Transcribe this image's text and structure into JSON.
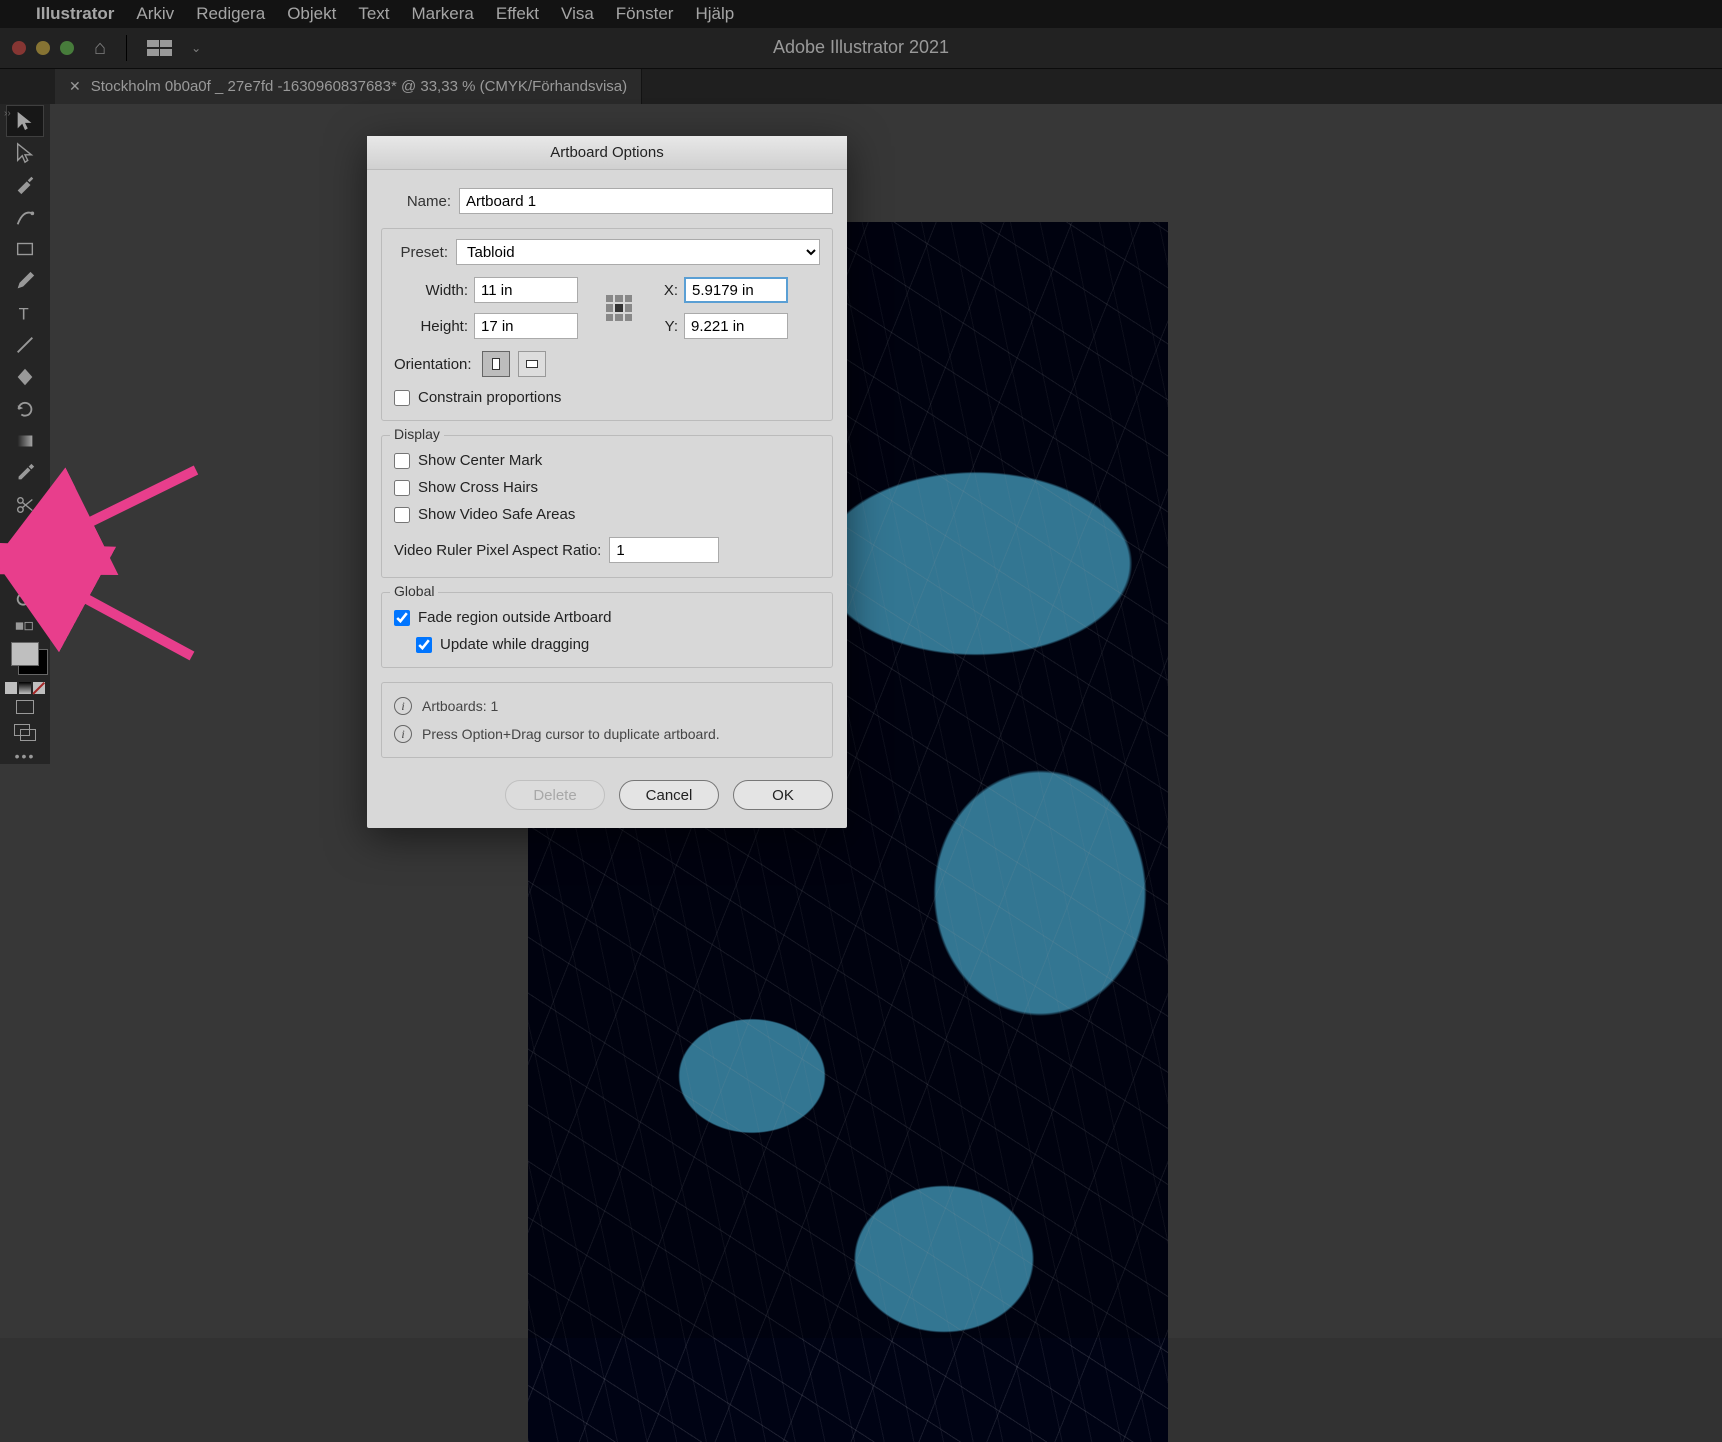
{
  "menubar": {
    "apple": "",
    "app": "Illustrator",
    "items": [
      "Arkiv",
      "Redigera",
      "Objekt",
      "Text",
      "Markera",
      "Effekt",
      "Visa",
      "Fönster",
      "Hjälp"
    ]
  },
  "chrome": {
    "title": "Adobe Illustrator 2021"
  },
  "tab": {
    "label": "Stockholm 0b0a0f _ 27e7fd -1630960837683* @ 33,33 % (CMYK/Förhandsvisa)"
  },
  "toolbar_icons": [
    "selection-tool",
    "direct-selection-tool",
    "pen-tool",
    "curvature-tool",
    "rectangle-tool",
    "paintbrush-tool",
    "type-tool",
    "line-tool",
    "shape-builder-tool",
    "rotate-tool",
    "gradient-tool",
    "eyedropper-tool",
    "scissors-tool",
    "hand-tool",
    "artboard-tool",
    "zoom-tool"
  ],
  "dialog": {
    "title": "Artboard Options",
    "name_label": "Name:",
    "name_value": "Artboard 1",
    "preset_label": "Preset:",
    "preset_value": "Tabloid",
    "width_label": "Width:",
    "width_value": "11 in",
    "height_label": "Height:",
    "height_value": "17 in",
    "x_label": "X:",
    "x_value": "5.9179 in",
    "y_label": "Y:",
    "y_value": "9.221 in",
    "orientation_label": "Orientation:",
    "constrain_label": "Constrain proportions",
    "display_legend": "Display",
    "show_center": "Show Center Mark",
    "show_cross": "Show Cross Hairs",
    "show_video": "Show Video Safe Areas",
    "aspect_label": "Video Ruler Pixel Aspect Ratio:",
    "aspect_value": "1",
    "global_legend": "Global",
    "fade_label": "Fade region outside Artboard",
    "update_label": "Update while dragging",
    "artboards_line": "Artboards: 1",
    "hint_line": "Press Option+Drag cursor to duplicate artboard.",
    "delete_btn": "Delete",
    "cancel_btn": "Cancel",
    "ok_btn": "OK"
  }
}
